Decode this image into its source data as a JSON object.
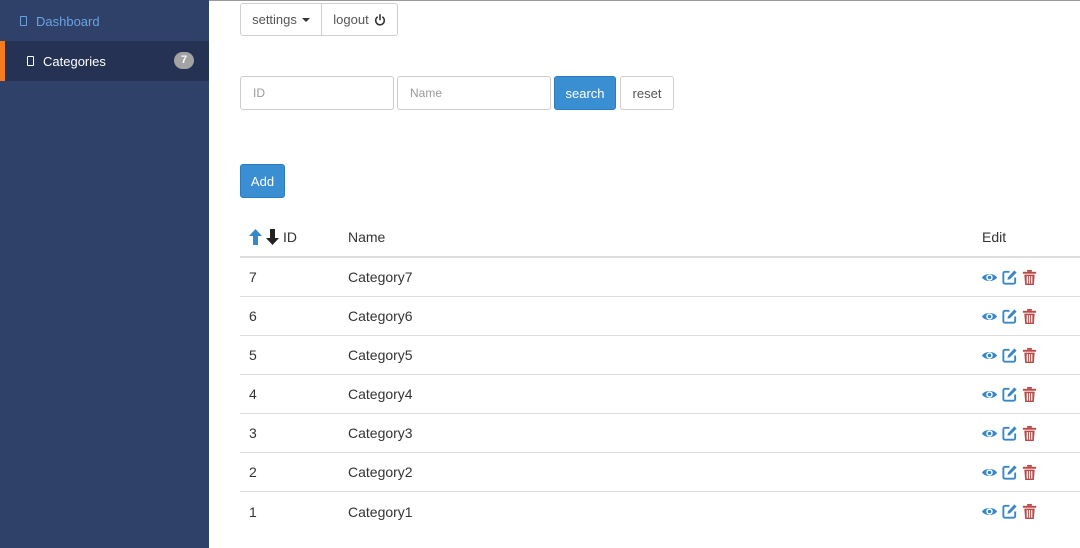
{
  "sidebar": {
    "items": [
      {
        "label": "Dashboard",
        "icon": "page-icon"
      },
      {
        "label": "Categories",
        "icon": "page-icon",
        "badge": "7",
        "active": true
      }
    ]
  },
  "toolbar": {
    "settings_label": "settings",
    "logout_label": "logout"
  },
  "filters": {
    "id_placeholder": "ID",
    "name_placeholder": "Name",
    "search_label": "search",
    "reset_label": "reset"
  },
  "add_label": "Add",
  "table": {
    "headers": {
      "id": "ID",
      "name": "Name",
      "edit": "Edit"
    },
    "rows": [
      {
        "id": "7",
        "name": "Category7"
      },
      {
        "id": "6",
        "name": "Category6"
      },
      {
        "id": "5",
        "name": "Category5"
      },
      {
        "id": "4",
        "name": "Category4"
      },
      {
        "id": "3",
        "name": "Category3"
      },
      {
        "id": "2",
        "name": "Category2"
      },
      {
        "id": "1",
        "name": "Category1"
      }
    ]
  },
  "colors": {
    "sidebar_bg": "#2f4169",
    "active_item_bg": "#253253",
    "active_accent": "#f47b20",
    "link_blue": "#6aa1e0",
    "primary_button": "#3a8fd3",
    "view_edit_icon": "#3a87c8",
    "delete_icon": "#b94a48"
  }
}
